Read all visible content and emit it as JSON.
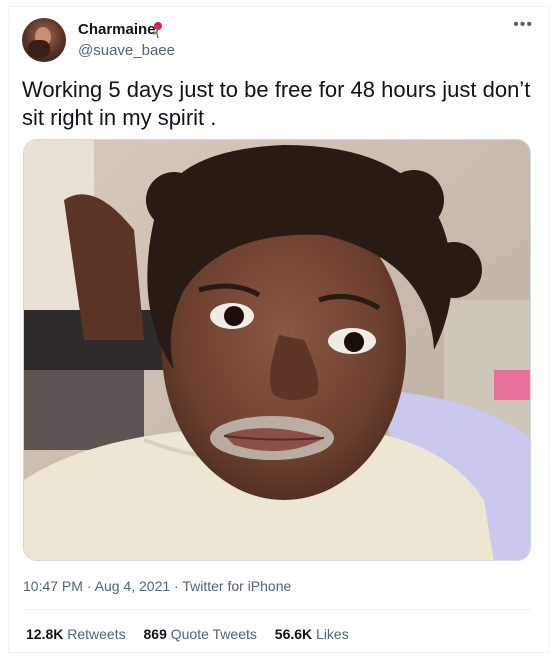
{
  "user": {
    "name": "Charmaine",
    "handle": "@suave_baee",
    "name_emoji": "rose-icon"
  },
  "more_icon": "more-horizontal-icon",
  "tweet": {
    "text": "Working 5 days just to be free for 48 hours just don’t sit right in my spirit ."
  },
  "meta": {
    "time": "10:47 PM",
    "date": "Aug 4, 2021",
    "source": "Twitter for iPhone",
    "separator": "·"
  },
  "stats": {
    "retweets_count": "12.8K",
    "retweets_label": "Retweets",
    "quotes_count": "869",
    "quotes_label": "Quote Tweets",
    "likes_count": "56.6K",
    "likes_label": "Likes"
  },
  "colors": {
    "text": "#0f1419",
    "secondary": "#536471",
    "border": "#eff3f4"
  }
}
